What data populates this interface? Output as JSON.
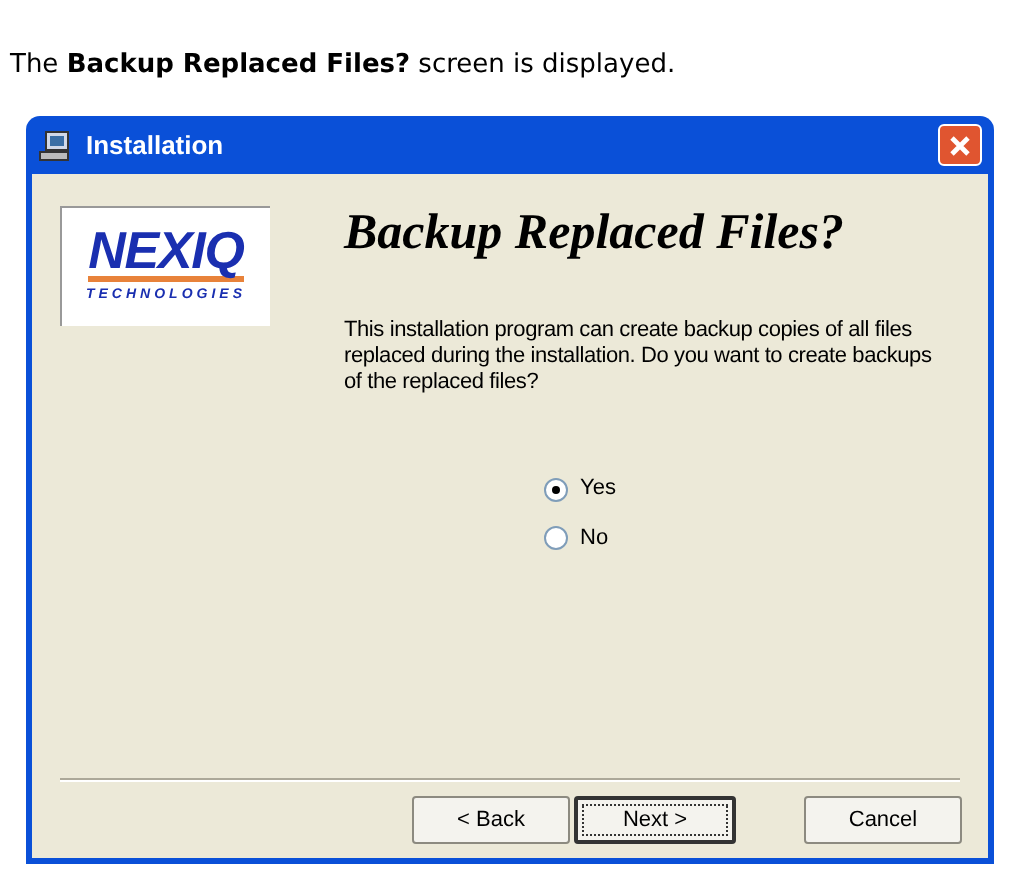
{
  "intro": "The **Backup Replaced Files?** screen is displayed.",
  "window": {
    "title": "Installation"
  },
  "logo": {
    "name": "NEXIQ",
    "tagline": "TECHNOLOGIES"
  },
  "heading": "Backup Replaced Files?",
  "message": "This installation program can create backup copies of all files replaced during the installation.  Do you want to create backups of the replaced files?",
  "options": [
    {
      "label": "Yes",
      "selected": true
    },
    {
      "label": "No",
      "selected": false
    }
  ],
  "buttons": [
    {
      "label": "< Back",
      "default": false
    },
    {
      "label": "Next >",
      "default": true
    },
    {
      "label": "Cancel",
      "default": false
    }
  ]
}
